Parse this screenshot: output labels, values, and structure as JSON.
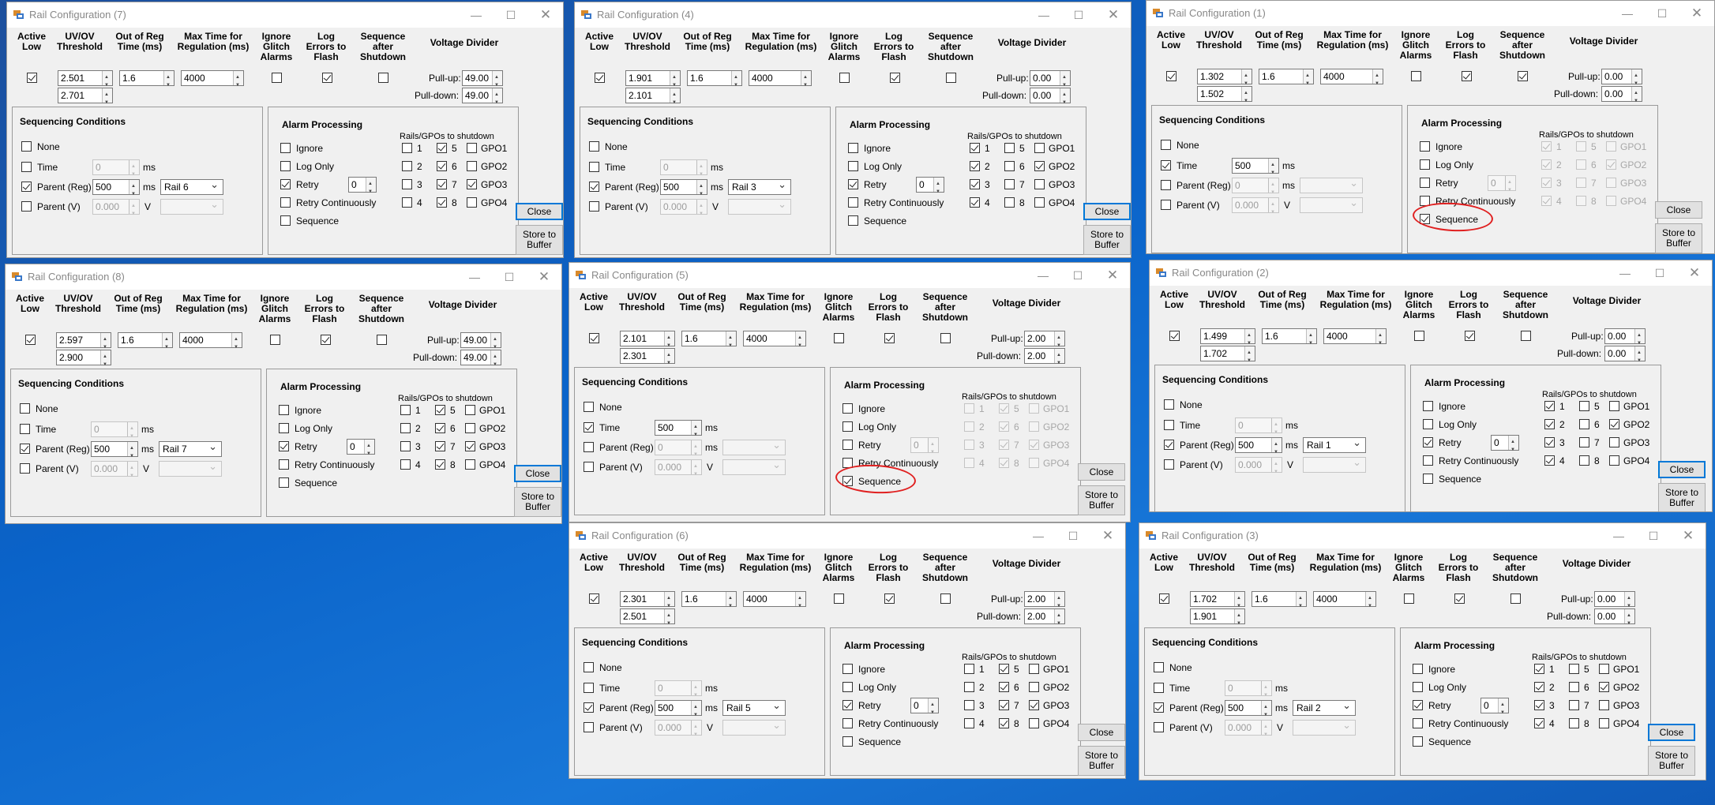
{
  "labels": {
    "active_low": "Active Low",
    "uvov": "UV/OV Threshold",
    "oor": "Out of Reg Time (ms)",
    "max_time": "Max Time for Regulation (ms)",
    "ignore_glitch": "Ignore Glitch Alarms",
    "log_errors": "Log Errors to Flash",
    "seq_after": "Sequence after Shutdown",
    "voltage_divider": "Voltage Divider",
    "pull_up": "Pull-up:",
    "pull_down": "Pull-down:",
    "seq_conditions": "Sequencing Conditions",
    "none": "None",
    "time": "Time",
    "parent_reg": "Parent (Reg)",
    "parent_v": "Parent (V)",
    "ms": "ms",
    "v": "V",
    "alarm_processing": "Alarm Processing",
    "ignore": "Ignore",
    "log_only": "Log Only",
    "retry": "Retry",
    "retry_cont": "Retry Continuously",
    "sequence": "Sequence",
    "rails_gpos": "Rails/GPOs to shutdown",
    "rail_labels": [
      "1",
      "2",
      "3",
      "4",
      "5",
      "6",
      "7",
      "8"
    ],
    "gpo_labels": [
      "GPO1",
      "GPO2",
      "GPO3",
      "GPO4"
    ],
    "close": "Close",
    "store": "Store to Buffer"
  },
  "windows": [
    {
      "title": "Rail Configuration (7)",
      "active_low": true,
      "uv": "2.501",
      "ov": "2.701",
      "oor": "1.6",
      "max": "4000",
      "ignore_glitch": false,
      "log_errors": true,
      "seq_after": false,
      "pull_up": "49.00",
      "pull_down": "49.00",
      "seq": {
        "none": false,
        "time": false,
        "time_val": "0",
        "parent_reg": true,
        "reg_val": "500",
        "parent_rail": "Rail 6",
        "parent_v": false,
        "v_val": "0.000"
      },
      "alarm": {
        "ignore": false,
        "log_only": false,
        "retry": true,
        "retry_val": "0",
        "retry_cont": false,
        "sequence": false,
        "disabled": false,
        "rails": [
          false,
          false,
          false,
          false,
          true,
          true,
          true,
          true
        ],
        "gpos": [
          false,
          false,
          true,
          false
        ]
      },
      "focused_close": true,
      "highlight": false
    },
    {
      "title": "Rail Configuration (4)",
      "active_low": true,
      "uv": "1.901",
      "ov": "2.101",
      "oor": "1.6",
      "max": "4000",
      "ignore_glitch": false,
      "log_errors": true,
      "seq_after": false,
      "pull_up": "0.00",
      "pull_down": "0.00",
      "seq": {
        "none": false,
        "time": false,
        "time_val": "0",
        "parent_reg": true,
        "reg_val": "500",
        "parent_rail": "Rail 3",
        "parent_v": false,
        "v_val": "0.000"
      },
      "alarm": {
        "ignore": false,
        "log_only": false,
        "retry": true,
        "retry_val": "0",
        "retry_cont": false,
        "sequence": false,
        "disabled": false,
        "rails": [
          true,
          true,
          true,
          true,
          false,
          false,
          false,
          false
        ],
        "gpos": [
          false,
          true,
          false,
          false
        ]
      },
      "focused_close": true,
      "highlight": false
    },
    {
      "title": "Rail Configuration (1)",
      "active_low": true,
      "uv": "1.302",
      "ov": "1.502",
      "oor": "1.6",
      "max": "4000",
      "ignore_glitch": false,
      "log_errors": true,
      "seq_after": true,
      "pull_up": "0.00",
      "pull_down": "0.00",
      "seq": {
        "none": false,
        "time": true,
        "time_val": "500",
        "parent_reg": false,
        "reg_val": "0",
        "parent_rail": "",
        "parent_v": false,
        "v_val": "0.000"
      },
      "alarm": {
        "ignore": false,
        "log_only": false,
        "retry": false,
        "retry_val": "0",
        "retry_cont": false,
        "sequence": true,
        "disabled": true,
        "rails": [
          true,
          true,
          true,
          true,
          false,
          false,
          false,
          false
        ],
        "gpos": [
          false,
          true,
          false,
          false
        ]
      },
      "focused_close": false,
      "highlight": true
    },
    {
      "title": "Rail Configuration (8)",
      "active_low": true,
      "uv": "2.597",
      "ov": "2.900",
      "oor": "1.6",
      "max": "4000",
      "ignore_glitch": false,
      "log_errors": true,
      "seq_after": false,
      "pull_up": "49.00",
      "pull_down": "49.00",
      "seq": {
        "none": false,
        "time": false,
        "time_val": "0",
        "parent_reg": true,
        "reg_val": "500",
        "parent_rail": "Rail 7",
        "parent_v": false,
        "v_val": "0.000"
      },
      "alarm": {
        "ignore": false,
        "log_only": false,
        "retry": true,
        "retry_val": "0",
        "retry_cont": false,
        "sequence": false,
        "disabled": false,
        "rails": [
          false,
          false,
          false,
          false,
          true,
          true,
          true,
          true
        ],
        "gpos": [
          false,
          false,
          true,
          false
        ]
      },
      "focused_close": true,
      "highlight": false
    },
    {
      "title": "Rail Configuration (5)",
      "active_low": true,
      "uv": "2.101",
      "ov": "2.301",
      "oor": "1.6",
      "max": "4000",
      "ignore_glitch": false,
      "log_errors": true,
      "seq_after": false,
      "pull_up": "2.00",
      "pull_down": "2.00",
      "seq": {
        "none": false,
        "time": true,
        "time_val": "500",
        "parent_reg": false,
        "reg_val": "0",
        "parent_rail": "",
        "parent_v": false,
        "v_val": "0.000"
      },
      "alarm": {
        "ignore": false,
        "log_only": false,
        "retry": false,
        "retry_val": "0",
        "retry_cont": false,
        "sequence": true,
        "disabled": true,
        "rails": [
          false,
          false,
          false,
          false,
          true,
          true,
          true,
          true
        ],
        "gpos": [
          false,
          false,
          true,
          false
        ]
      },
      "focused_close": false,
      "highlight": true
    },
    {
      "title": "Rail Configuration (2)",
      "active_low": true,
      "uv": "1.499",
      "ov": "1.702",
      "oor": "1.6",
      "max": "4000",
      "ignore_glitch": false,
      "log_errors": true,
      "seq_after": false,
      "pull_up": "0.00",
      "pull_down": "0.00",
      "seq": {
        "none": false,
        "time": false,
        "time_val": "0",
        "parent_reg": true,
        "reg_val": "500",
        "parent_rail": "Rail 1",
        "parent_v": false,
        "v_val": "0.000"
      },
      "alarm": {
        "ignore": false,
        "log_only": false,
        "retry": true,
        "retry_val": "0",
        "retry_cont": false,
        "sequence": false,
        "disabled": false,
        "rails": [
          true,
          true,
          true,
          true,
          false,
          false,
          false,
          false
        ],
        "gpos": [
          false,
          true,
          false,
          false
        ]
      },
      "focused_close": true,
      "highlight": false
    },
    {
      "title": "Rail Configuration (6)",
      "active_low": true,
      "uv": "2.301",
      "ov": "2.501",
      "oor": "1.6",
      "max": "4000",
      "ignore_glitch": false,
      "log_errors": true,
      "seq_after": false,
      "pull_up": "2.00",
      "pull_down": "2.00",
      "seq": {
        "none": false,
        "time": false,
        "time_val": "0",
        "parent_reg": true,
        "reg_val": "500",
        "parent_rail": "Rail 5",
        "parent_v": false,
        "v_val": "0.000"
      },
      "alarm": {
        "ignore": false,
        "log_only": false,
        "retry": true,
        "retry_val": "0",
        "retry_cont": false,
        "sequence": false,
        "disabled": false,
        "rails": [
          false,
          false,
          false,
          false,
          true,
          true,
          true,
          true
        ],
        "gpos": [
          false,
          false,
          true,
          false
        ]
      },
      "focused_close": false,
      "highlight": false
    },
    {
      "title": "Rail Configuration (3)",
      "active_low": true,
      "uv": "1.702",
      "ov": "1.901",
      "oor": "1.6",
      "max": "4000",
      "ignore_glitch": false,
      "log_errors": true,
      "seq_after": false,
      "pull_up": "0.00",
      "pull_down": "0.00",
      "seq": {
        "none": false,
        "time": false,
        "time_val": "0",
        "parent_reg": true,
        "reg_val": "500",
        "parent_rail": "Rail 2",
        "parent_v": false,
        "v_val": "0.000"
      },
      "alarm": {
        "ignore": false,
        "log_only": false,
        "retry": true,
        "retry_val": "0",
        "retry_cont": false,
        "sequence": false,
        "disabled": false,
        "rails": [
          true,
          true,
          true,
          true,
          false,
          false,
          false,
          false
        ],
        "gpos": [
          false,
          true,
          false,
          false
        ]
      },
      "focused_close": true,
      "highlight": false
    }
  ]
}
